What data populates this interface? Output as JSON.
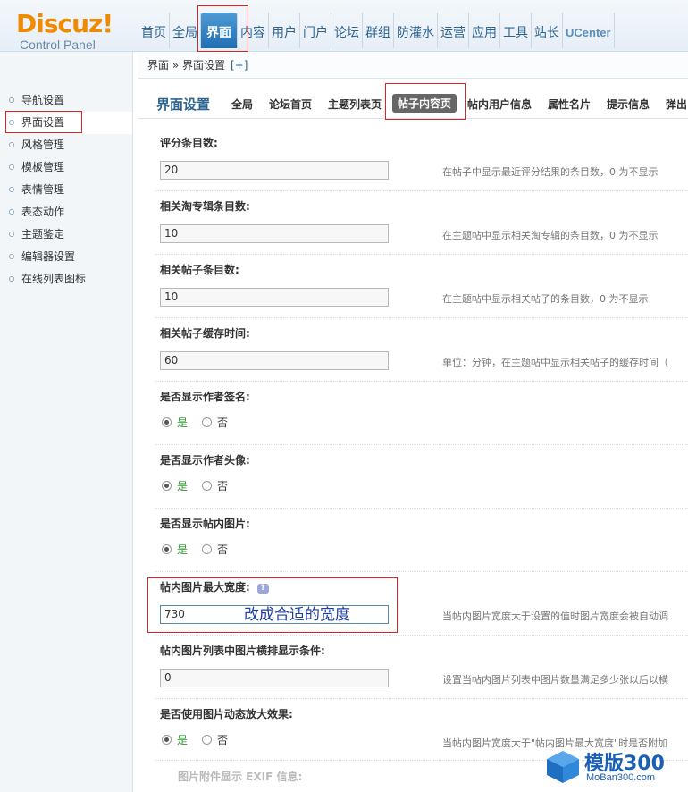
{
  "logo": {
    "word": "Discuz!",
    "subtitle": "Control Panel"
  },
  "topnav": [
    "首页",
    "全局",
    "界面",
    "内容",
    "用户",
    "门户",
    "论坛",
    "群组",
    "防灌水",
    "运营",
    "应用",
    "工具",
    "站长",
    "UCenter"
  ],
  "breadcrumb": {
    "text": "界面 » 界面设置",
    "plus": "[+]"
  },
  "sidebar": [
    "导航设置",
    "界面设置",
    "风格管理",
    "模板管理",
    "表情管理",
    "表态动作",
    "主题鉴定",
    "编辑器设置",
    "在线列表图标"
  ],
  "page_title": "界面设置",
  "tabs": [
    "全局",
    "论坛首页",
    "主题列表页",
    "帖子内容页",
    "帖内用户信息",
    "属性名片",
    "提示信息",
    "弹出"
  ],
  "fields": [
    {
      "title": "评分条目数:",
      "value": "20",
      "tip": "在帖子中显示最近评分结果的条目数，0 为不显示"
    },
    {
      "title": "相关淘专辑条目数:",
      "value": "10",
      "tip": "在主题帖中显示相关淘专辑的条目数，0 为不显示"
    },
    {
      "title": "相关帖子条目数:",
      "value": "10",
      "tip": "在主题帖中显示相关帖子的条目数，0 为不显示"
    },
    {
      "title": "相关帖子缓存时间:",
      "value": "60",
      "tip": "单位：分钟，在主题帖中显示相关帖子的缓存时间（"
    }
  ],
  "radios": [
    {
      "title": "是否显示作者签名:",
      "yes": "是",
      "no": "否"
    },
    {
      "title": "是否显示作者头像:",
      "yes": "是",
      "no": "否"
    },
    {
      "title": "是否显示帖内图片:",
      "yes": "是",
      "no": "否"
    }
  ],
  "width_field": {
    "title": "帖内图片最大宽度:",
    "value": "730",
    "annotation": "改成合适的宽度",
    "tip": "当帖内图片宽度大于设置的值时图片宽度会被自动调"
  },
  "list_field": {
    "title": "帖内图片列表中图片横排显示条件:",
    "value": "0",
    "tip": "设置当帖内图片列表中图片数量满足多少张以后以横"
  },
  "zoom_field": {
    "title": "是否使用图片动态放大效果:",
    "yes": "是",
    "no": "否",
    "tip": "当帖内图片宽度大于\"帖内图片最大宽度\"时是否附加"
  },
  "exif_field": {
    "title": "图片附件显示 EXIF 信息:"
  },
  "watermark": {
    "brand": "模版300",
    "url": "MoBan300.com"
  },
  "colors": {
    "accent": "#2d6490",
    "highlight": "#dd2222",
    "logo": "#f08a00"
  }
}
